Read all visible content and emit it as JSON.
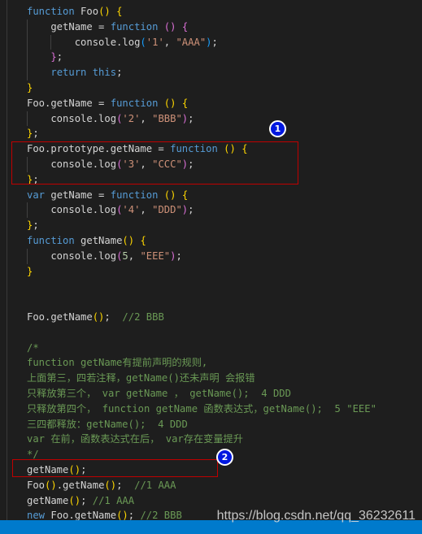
{
  "colors": {
    "background": "#1e1e1e",
    "keyword": "#569cd6",
    "string": "#ce9178",
    "comment": "#6a9955",
    "status_bar": "#007acc",
    "highlight_box": "#c00000",
    "badge": "#0018e0"
  },
  "annotations": [
    {
      "label": "1"
    },
    {
      "label": "2"
    }
  ],
  "watermark": "https://blog.csdn.net/qq_36232611",
  "code_lines": [
    [
      [
        "function ",
        "kw"
      ],
      [
        "Foo",
        "txt"
      ],
      [
        "()",
        "b1"
      ],
      [
        " ",
        "txt"
      ],
      [
        "{",
        "b1"
      ]
    ],
    [
      [
        "    getName = ",
        "txt"
      ],
      [
        "function ",
        "kw"
      ],
      [
        "()",
        "b2"
      ],
      [
        " ",
        "txt"
      ],
      [
        "{",
        "b2"
      ]
    ],
    [
      [
        "        console.log",
        "txt"
      ],
      [
        "(",
        "b3"
      ],
      [
        "'1'",
        "str"
      ],
      [
        ", ",
        "txt"
      ],
      [
        "\"AAA\"",
        "str"
      ],
      [
        ")",
        "b3"
      ],
      [
        ";",
        "txt"
      ]
    ],
    [
      [
        "    ",
        "txt"
      ],
      [
        "}",
        "b2"
      ],
      [
        ";",
        "txt"
      ]
    ],
    [
      [
        "    ",
        "txt"
      ],
      [
        "return this",
        "kw"
      ],
      [
        ";",
        "txt"
      ]
    ],
    [
      [
        "}",
        "b1"
      ]
    ],
    [
      [
        "Foo.getName = ",
        "txt"
      ],
      [
        "function ",
        "kw"
      ],
      [
        "()",
        "b1"
      ],
      [
        " ",
        "txt"
      ],
      [
        "{",
        "b1"
      ]
    ],
    [
      [
        "    console.log",
        "txt"
      ],
      [
        "(",
        "b2"
      ],
      [
        "'2'",
        "str"
      ],
      [
        ", ",
        "txt"
      ],
      [
        "\"BBB\"",
        "str"
      ],
      [
        ")",
        "b2"
      ],
      [
        ";",
        "txt"
      ]
    ],
    [
      [
        "}",
        "b1"
      ],
      [
        ";",
        "txt"
      ]
    ],
    [
      [
        "Foo.prototype.getName = ",
        "txt"
      ],
      [
        "function ",
        "kw"
      ],
      [
        "()",
        "b1"
      ],
      [
        " ",
        "txt"
      ],
      [
        "{",
        "b1"
      ]
    ],
    [
      [
        "    console.log",
        "txt"
      ],
      [
        "(",
        "b2"
      ],
      [
        "'3'",
        "str"
      ],
      [
        ", ",
        "txt"
      ],
      [
        "\"CCC\"",
        "str"
      ],
      [
        ")",
        "b2"
      ],
      [
        ";",
        "txt"
      ]
    ],
    [
      [
        "}",
        "b1"
      ],
      [
        ";",
        "txt"
      ]
    ],
    [
      [
        "var ",
        "kw"
      ],
      [
        "getName = ",
        "txt"
      ],
      [
        "function ",
        "kw"
      ],
      [
        "()",
        "b1"
      ],
      [
        " ",
        "txt"
      ],
      [
        "{",
        "b1"
      ]
    ],
    [
      [
        "    console.log",
        "txt"
      ],
      [
        "(",
        "b2"
      ],
      [
        "'4'",
        "str"
      ],
      [
        ", ",
        "txt"
      ],
      [
        "\"DDD\"",
        "str"
      ],
      [
        ")",
        "b2"
      ],
      [
        ";",
        "txt"
      ]
    ],
    [
      [
        "}",
        "b1"
      ],
      [
        ";",
        "txt"
      ]
    ],
    [
      [
        "function ",
        "kw"
      ],
      [
        "getName",
        "txt"
      ],
      [
        "()",
        "b1"
      ],
      [
        " ",
        "txt"
      ],
      [
        "{",
        "b1"
      ]
    ],
    [
      [
        "    console.log",
        "txt"
      ],
      [
        "(",
        "b2"
      ],
      [
        "5",
        "num"
      ],
      [
        ", ",
        "txt"
      ],
      [
        "\"EEE\"",
        "str"
      ],
      [
        ")",
        "b2"
      ],
      [
        ";",
        "txt"
      ]
    ],
    [
      [
        "}",
        "b1"
      ]
    ],
    [],
    [],
    [
      [
        "Foo.getName",
        "txt"
      ],
      [
        "()",
        "b1"
      ],
      [
        ";  ",
        "txt"
      ],
      [
        "//2 BBB",
        "com"
      ]
    ],
    [],
    [
      [
        "/*",
        "com"
      ]
    ],
    [
      [
        "function getName有提前声明的规则,",
        "com"
      ]
    ],
    [
      [
        "上面第三，四若注释，getName()还未声明 会报错",
        "com"
      ]
    ],
    [
      [
        "只释放第三个， var getName ， getName();  4 DDD",
        "com"
      ]
    ],
    [
      [
        "只释放第四个， function getName 函数表达式，getName();  5 \"EEE\"",
        "com"
      ]
    ],
    [
      [
        "三四都释放：getName();  4 DDD",
        "com"
      ]
    ],
    [
      [
        "var 在前，函数表达式在后， var存在变量提升",
        "com"
      ]
    ],
    [
      [
        "*/",
        "com"
      ]
    ],
    [
      [
        "getName",
        "txt"
      ],
      [
        "()",
        "b1"
      ],
      [
        ";",
        "txt"
      ]
    ],
    [
      [
        "Foo",
        "txt"
      ],
      [
        "()",
        "b1"
      ],
      [
        ".getName",
        "txt"
      ],
      [
        "()",
        "b1"
      ],
      [
        ";  ",
        "txt"
      ],
      [
        "//1 AAA",
        "com"
      ]
    ],
    [
      [
        "getName",
        "txt"
      ],
      [
        "()",
        "b1"
      ],
      [
        "; ",
        "txt"
      ],
      [
        "//1 AAA",
        "com"
      ]
    ],
    [
      [
        "new ",
        "kw"
      ],
      [
        "Foo.getName",
        "txt"
      ],
      [
        "()",
        "b1"
      ],
      [
        "; ",
        "txt"
      ],
      [
        "//2 BBB",
        "com"
      ]
    ]
  ]
}
